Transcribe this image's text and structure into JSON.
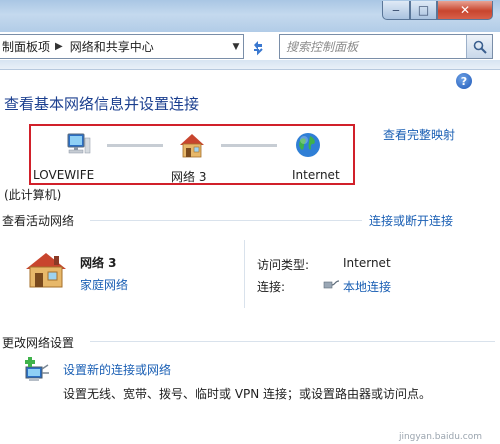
{
  "window": {
    "minimize_glyph": "‒",
    "maximize_glyph": "□",
    "close_glyph": "✕"
  },
  "address": {
    "crumb_1": "制面板项",
    "crumb_2": "网络和共享中心",
    "separator": "▶",
    "dropdown": "▼"
  },
  "search": {
    "placeholder": "搜索控制面板"
  },
  "help_glyph": "?",
  "main": {
    "title": "查看基本网络信息并设置连接",
    "view_full_map": "查看完整映射",
    "map": {
      "computer": "LOVEWIFE",
      "computer_sub": "(此计算机)",
      "network": "网络 3",
      "internet": "Internet"
    },
    "active": {
      "header": "查看活动网络",
      "connect_link": "连接或断开连接",
      "network_name": "网络 3",
      "network_type": "家庭网络",
      "access_type_label": "访问类型:",
      "access_type_value": "Internet",
      "connections_label": "连接:",
      "connections_value": "本地连接"
    },
    "change": {
      "header": "更改网络设置",
      "setup_link": "设置新的连接或网络",
      "setup_desc": "设置无线、宽带、拨号、临时或 VPN 连接；或设置路由器或访问点。"
    }
  },
  "watermark": "jingyan.baidu.com",
  "colors": {
    "accent": "#1a5fb4",
    "highlight": "#d1202a",
    "title": "#1b3f8f"
  }
}
